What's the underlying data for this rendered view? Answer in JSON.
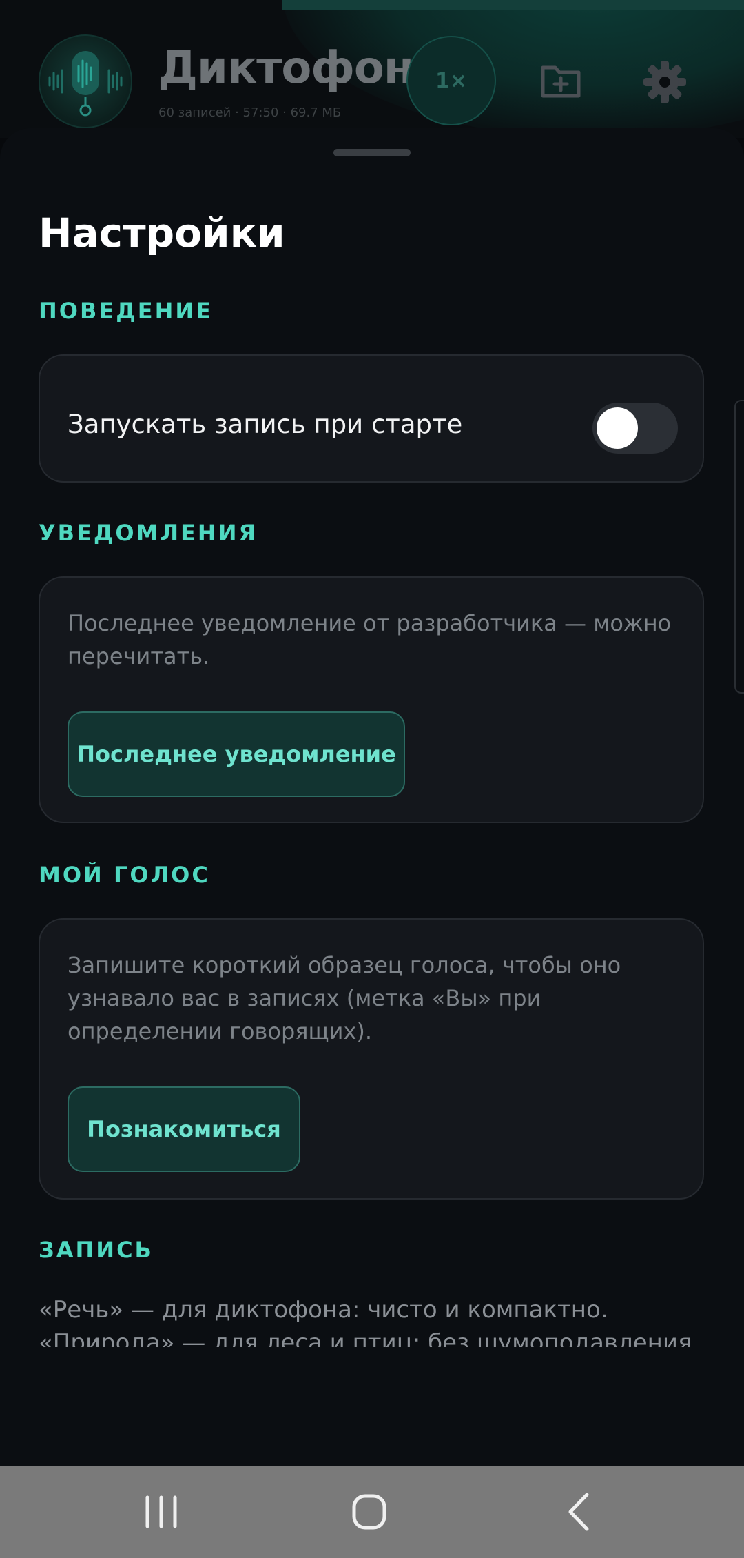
{
  "header": {
    "title": "Диктофон",
    "subtitle": "60 записей · 57:50 · 69.7 МБ",
    "speed": "1×"
  },
  "settings": {
    "title": "Настройки",
    "behavior": {
      "label": "ПОВЕДЕНИЕ",
      "autostart_label": "Запускать запись при старте",
      "autostart_enabled": false
    },
    "notifications": {
      "label": "УВЕДОМЛЕНИЯ",
      "description": "Последнее уведомление от разработчика — можно перечитать.",
      "button": "Последнее уведомление"
    },
    "voice": {
      "label": "МОЙ ГОЛОС",
      "description": "Запишите короткий образец голоса, чтобы оно узнавало вас в записях (метка «Вы» при определении говорящих).",
      "button": "Познакомиться"
    },
    "recording": {
      "label": "ЗАПИСЬ",
      "text_line1": "«Речь» — для диктофона: чисто и компактно.",
      "text_line2": "«Природа» — для леса и птиц: без шумоподавления"
    }
  },
  "colors": {
    "accent": "#4fd8c0",
    "background": "#0b0e12",
    "card": "#14171c"
  },
  "icons": [
    "microphone-logo-icon",
    "folder-add-icon",
    "gear-icon",
    "recent-apps-icon",
    "home-icon",
    "back-icon"
  ]
}
